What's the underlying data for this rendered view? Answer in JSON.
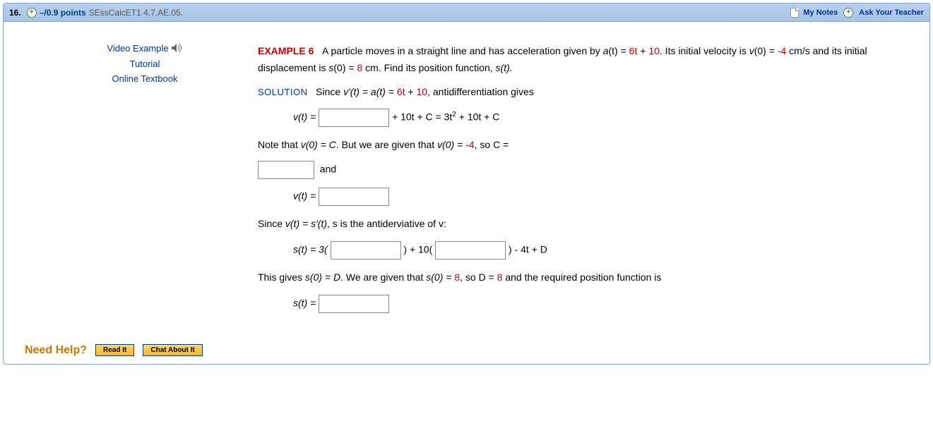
{
  "header": {
    "number": "16.",
    "points": "–/0.9 points",
    "assignment": "SEssCalcET1 4.7.AE.05.",
    "my_notes": "My Notes",
    "ask_teacher": "Ask Your Teacher"
  },
  "sidebar": {
    "video": "Video Example",
    "tutorial": "Tutorial",
    "textbook": "Online Textbook"
  },
  "content": {
    "example_label": "EXAMPLE 6",
    "intro_1": "A particle moves in a straight line and has acceleration given by ",
    "a_expr": "a",
    "a_of_t": "(t) = ",
    "val_6t": "6t",
    "plus": " + ",
    "val_10": "10",
    "intro_2": ". Its initial velocity is ",
    "v_expr": "v",
    "v0_eq": "(0) = ",
    "neg4": "-4",
    "cms": " cm/s and its initial displacement is ",
    "s_expr": "s",
    "s0_eq": "(0) = ",
    "eight": "8",
    "cm_find": " cm. Find its position function, ",
    "s_t": "s(t).",
    "solution_label": "SOLUTION",
    "since_1": "Since ",
    "vp_t": "v'(t) = a(t) = ",
    "antidiff": ", antidifferentiation gives",
    "vt_eq": "v(t) = ",
    "plus_10t_c": " + 10t + C = 3t",
    "sq": "2",
    "plus_10t_c2": " + 10t + C",
    "note_v0": "Note that ",
    "v0c": "v(0) = C",
    "but_given": ". But we are given that ",
    "v0_eq2": "v(0) = ",
    "so_c": ", so C =",
    "and": "and",
    "since_vs": "Since ",
    "vt_spt": "v(t) = s'(t)",
    "s_antider": ", s is the antiderviative of v:",
    "st_eq": "s(t) = 3(",
    "close_10": ") + 10(",
    "close_4td": ") - 4t + D",
    "gives_s0d": "This gives ",
    "s0d": "s(0) = D",
    "given_s0": ". We are given that ",
    "s0_8": "s(0) = ",
    "so_d": ", so D = ",
    "req_pos": " and the required position function is",
    "st_final": "s(t) = "
  },
  "help": {
    "label": "Need Help?",
    "read": "Read It",
    "chat": "Chat About It"
  }
}
